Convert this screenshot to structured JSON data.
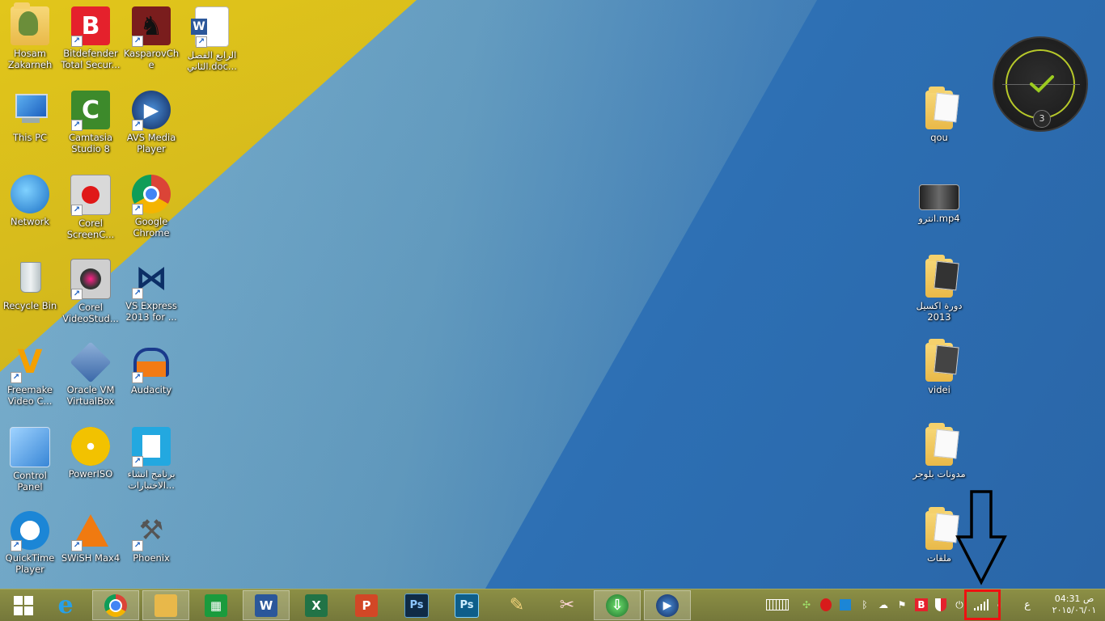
{
  "desktop_icons_left": [
    {
      "label": "Hosam\nZakarneh",
      "icon": "user-folder-icon"
    },
    {
      "label": "Bitdefender\nTotal Secur...",
      "icon": "bitdefender-icon"
    },
    {
      "label": "KasparovChe",
      "icon": "chess-knight-icon"
    },
    {
      "label": "الرابع الفصل\nالثاني.doc...",
      "icon": "word-document-icon"
    },
    {
      "label": "This PC",
      "icon": "computer-icon"
    },
    {
      "label": "Camtasia\nStudio 8",
      "icon": "camtasia-icon"
    },
    {
      "label": "AVS Media\nPlayer",
      "icon": "media-player-icon"
    },
    {
      "label": "Network",
      "icon": "network-globe-icon"
    },
    {
      "label": "Corel\nScreenC...",
      "icon": "record-icon"
    },
    {
      "label": "Google\nChrome",
      "icon": "chrome-icon"
    },
    {
      "label": "Recycle Bin",
      "icon": "recycle-bin-icon"
    },
    {
      "label": "Corel\nVideoStud...",
      "icon": "video-studio-icon"
    },
    {
      "label": "VS Express\n2013 for ...",
      "icon": "visual-studio-icon"
    },
    {
      "label": "Freemake\nVideo C...",
      "icon": "freemake-icon"
    },
    {
      "label": "Oracle VM\nVirtualBox",
      "icon": "virtualbox-icon"
    },
    {
      "label": "Audacity",
      "icon": "audacity-icon"
    },
    {
      "label": "Control\nPanel",
      "icon": "control-panel-icon"
    },
    {
      "label": "PowerISO",
      "icon": "disc-icon"
    },
    {
      "label": "برنامج انشاء\nالاختبارات...",
      "icon": "document-icon"
    },
    {
      "label": "QuickTime\nPlayer",
      "icon": "quicktime-icon"
    },
    {
      "label": "SWiSH Max4",
      "icon": "swish-icon"
    },
    {
      "label": "Phoenix",
      "icon": "phoenix-tools-icon"
    }
  ],
  "desktop_icons_right": [
    {
      "label": "qou",
      "icon": "folder-icon"
    },
    {
      "label": "انترو.mp4",
      "icon": "video-file-icon"
    },
    {
      "label": "دورة اكسيل\n2013",
      "icon": "folder-icon"
    },
    {
      "label": "videi",
      "icon": "folder-icon"
    },
    {
      "label": "مدونات بلوجر",
      "icon": "folder-icon"
    },
    {
      "label": "ملفات",
      "icon": "folder-icon"
    }
  ],
  "gadget": {
    "badge": "3",
    "icon": "checkmark-icon"
  },
  "taskbar": {
    "apps": [
      {
        "name": "start",
        "glyph": "⊞",
        "color": "#ffffff"
      },
      {
        "name": "internet-explorer",
        "glyph": "e",
        "color": "#1e88e5"
      },
      {
        "name": "chrome",
        "glyph": "◉",
        "color": "#db4437"
      },
      {
        "name": "file-explorer",
        "glyph": "▤",
        "color": "#e8b84a"
      },
      {
        "name": "store",
        "glyph": "▦",
        "color": "#1a9b3d"
      },
      {
        "name": "word",
        "glyph": "W",
        "color": "#2b579a"
      },
      {
        "name": "excel",
        "glyph": "X",
        "color": "#217346"
      },
      {
        "name": "powerpoint",
        "glyph": "P",
        "color": "#d24726"
      },
      {
        "name": "photoshop-1",
        "glyph": "Ps",
        "color": "#0f2b46"
      },
      {
        "name": "photoshop-2",
        "glyph": "Ps",
        "color": "#0d5e8a"
      },
      {
        "name": "paint",
        "glyph": "✎",
        "color": "#c9a455"
      },
      {
        "name": "snipping",
        "glyph": "✂",
        "color": "#b3474a"
      },
      {
        "name": "idm",
        "glyph": "⇩",
        "color": "#2a8a3a"
      },
      {
        "name": "media-player",
        "glyph": "▶",
        "color": "#1e3a5f"
      }
    ],
    "tray_icons": [
      "keyboard-icon",
      "network-tray-icon",
      "antivirus-tray-icon",
      "app-tray-icon",
      "bluetooth-icon",
      "onedrive-icon",
      "flag-icon",
      "bitdefender-tray-icon",
      "shield-tray-icon",
      "power-icon",
      "signal-bars-icon",
      "volume-icon"
    ],
    "language": "ع",
    "time": "04:31 ص",
    "date": "٢٠١٥/٠٦/٠١"
  }
}
